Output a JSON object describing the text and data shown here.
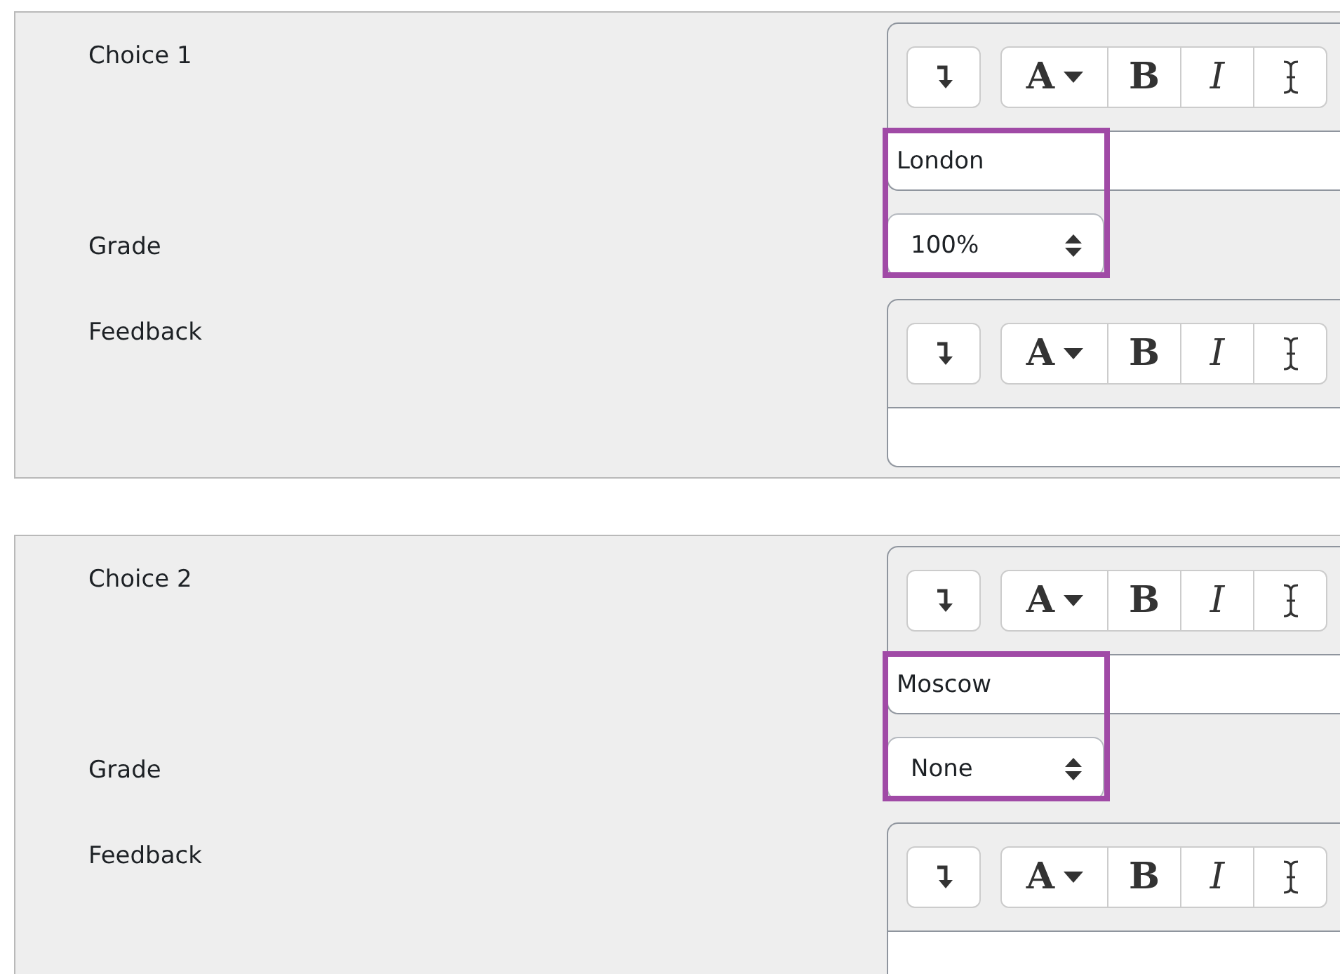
{
  "choices": [
    {
      "label": "Choice 1",
      "answer": {
        "toolbar": [
          {
            "kind": "insert"
          },
          {
            "kind": "font",
            "text": "A"
          },
          {
            "kind": "bold",
            "text": "B"
          },
          {
            "kind": "italic",
            "text": "I"
          },
          {
            "kind": "cursor"
          }
        ],
        "value": "London"
      },
      "highlighted": true,
      "grade_label": "Grade",
      "grade": "100%",
      "feedback_label": "Feedback",
      "feedback": {
        "toolbar": [
          {
            "kind": "insert"
          },
          {
            "kind": "font",
            "text": "A"
          },
          {
            "kind": "bold",
            "text": "B"
          },
          {
            "kind": "italic",
            "text": "I"
          },
          {
            "kind": "cursor"
          }
        ]
      }
    },
    {
      "label": "Choice 2",
      "answer": {
        "toolbar": [
          {
            "kind": "insert"
          },
          {
            "kind": "font",
            "text": "A"
          },
          {
            "kind": "bold",
            "text": "B"
          },
          {
            "kind": "italic",
            "text": "I"
          },
          {
            "kind": "cursor"
          }
        ],
        "value": "Moscow"
      },
      "highlighted": true,
      "grade_label": "Grade",
      "grade": "None",
      "feedback_label": "Feedback",
      "feedback": {
        "toolbar": [
          {
            "kind": "insert"
          },
          {
            "kind": "font",
            "text": "A"
          },
          {
            "kind": "bold",
            "text": "B"
          },
          {
            "kind": "italic",
            "text": "I"
          },
          {
            "kind": "cursor"
          }
        ]
      }
    }
  ]
}
